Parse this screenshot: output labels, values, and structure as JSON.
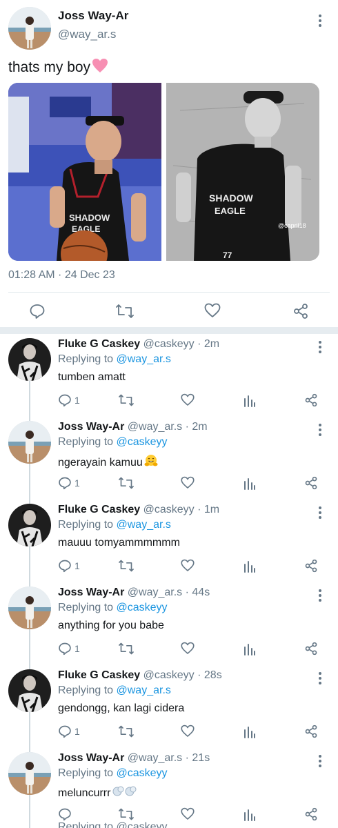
{
  "main_tweet": {
    "display_name": "Joss Way-Ar",
    "handle": "@way_ar.s",
    "text": "thats my boy",
    "text_emoji": "pink-heart",
    "timestamp": "01:28 AM · 24 Dec 23",
    "media": [
      {
        "description_icon": "photo-basketball-player",
        "jersey_text": "SHADOW EAGLE"
      },
      {
        "description_icon": "photo-bw-player",
        "jersey_text": "SHADOW EAGLE",
        "jersey_number": "77",
        "watermark": "@capril18"
      }
    ]
  },
  "replies": [
    {
      "name": "Fluke G Caskey",
      "handle": "@caskeyy",
      "time": "2m",
      "replying_label": "Replying to",
      "replying_to": "@way_ar.s",
      "text": "tumben amatt",
      "emoji": "",
      "reply_count": "1"
    },
    {
      "name": "Joss Way-Ar",
      "handle": "@way_ar.s",
      "time": "2m",
      "replying_label": "Replying to",
      "replying_to": "@caskeyy",
      "text": "ngerayain kamuu",
      "emoji": "hugging-face",
      "reply_count": "1"
    },
    {
      "name": "Fluke G Caskey",
      "handle": "@caskeyy",
      "time": "1m",
      "replying_label": "Replying to",
      "replying_to": "@way_ar.s",
      "text": "mauuu tomyammmmmm",
      "emoji": "",
      "reply_count": "1"
    },
    {
      "name": "Joss Way-Ar",
      "handle": "@way_ar.s",
      "time": "44s",
      "replying_label": "Replying to",
      "replying_to": "@caskeyy",
      "text": "anything for you babe",
      "emoji": "",
      "reply_count": "1"
    },
    {
      "name": "Fluke G Caskey",
      "handle": "@caskeyy",
      "time": "28s",
      "replying_label": "Replying to",
      "replying_to": "@way_ar.s",
      "text": "gendongg, kan lagi cidera",
      "emoji": "",
      "reply_count": "1"
    },
    {
      "name": "Joss Way-Ar",
      "handle": "@way_ar.s",
      "time": "21s",
      "replying_label": "Replying to",
      "replying_to": "@caskeyy",
      "text": "meluncurrr",
      "emoji": "dash-puffs",
      "reply_count": ""
    }
  ],
  "partial_next": {
    "text": "Replying to @caskeyy"
  },
  "colors": {
    "accent": "#1b95e0",
    "secondary_text": "#657786",
    "primary_text": "#14171a",
    "divider": "#e1e8ed",
    "heart_emoji": "#f78fb3"
  }
}
